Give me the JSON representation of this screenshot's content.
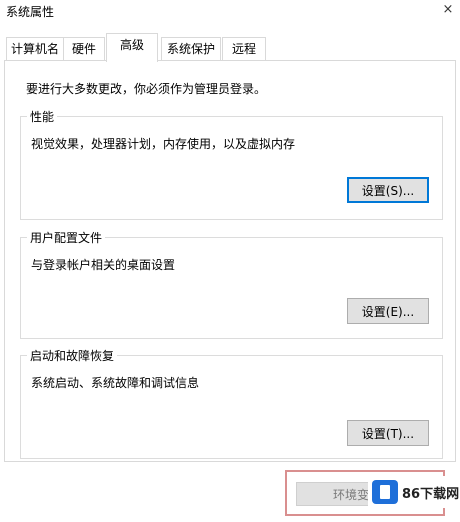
{
  "window": {
    "title": "系统属性",
    "close_label": "×"
  },
  "tabs": [
    {
      "label": "计算机名"
    },
    {
      "label": "硬件"
    },
    {
      "label": "高级"
    },
    {
      "label": "系统保护"
    },
    {
      "label": "远程"
    }
  ],
  "active_tab": "高级",
  "admin_note": "要进行大多数更改，你必须作为管理员登录。",
  "performance": {
    "title": "性能",
    "description": "视觉效果，处理器计划，内存使用，以及虚拟内存",
    "button": "设置(S)..."
  },
  "user_profiles": {
    "title": "用户配置文件",
    "description": "与登录帐户相关的桌面设置",
    "button": "设置(E)..."
  },
  "startup_recovery": {
    "title": "启动和故障恢复",
    "description": "系统启动、系统故障和调试信息",
    "button": "设置(T)..."
  },
  "env_button": "环境变",
  "watermark": {
    "text": "86下载网"
  },
  "colors": {
    "focus_border": "#0078d7",
    "highlight_box": "#d98f8f",
    "watermark_logo": "#1e6fd9"
  }
}
